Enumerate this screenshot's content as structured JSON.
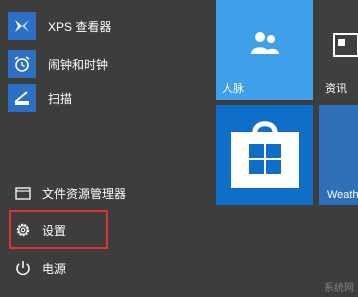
{
  "apps": [
    {
      "label": "XPS 查看器",
      "icon": "xps-viewer-icon"
    },
    {
      "label": "闹钟和时钟",
      "icon": "alarm-clock-icon"
    },
    {
      "label": "扫描",
      "icon": "scanner-icon"
    }
  ],
  "system": {
    "file_explorer": "文件资源管理器",
    "settings": "设置",
    "power": "电源"
  },
  "tiles": {
    "people": "人脉",
    "news": "资讯",
    "store": "",
    "weather": "Weath"
  },
  "watermark": "系统网",
  "colors": {
    "tile_light": "#3f9fe8",
    "tile_dark": "#0f6fc8",
    "app_icon": "#2d6fc2",
    "highlight": "#e03034"
  }
}
